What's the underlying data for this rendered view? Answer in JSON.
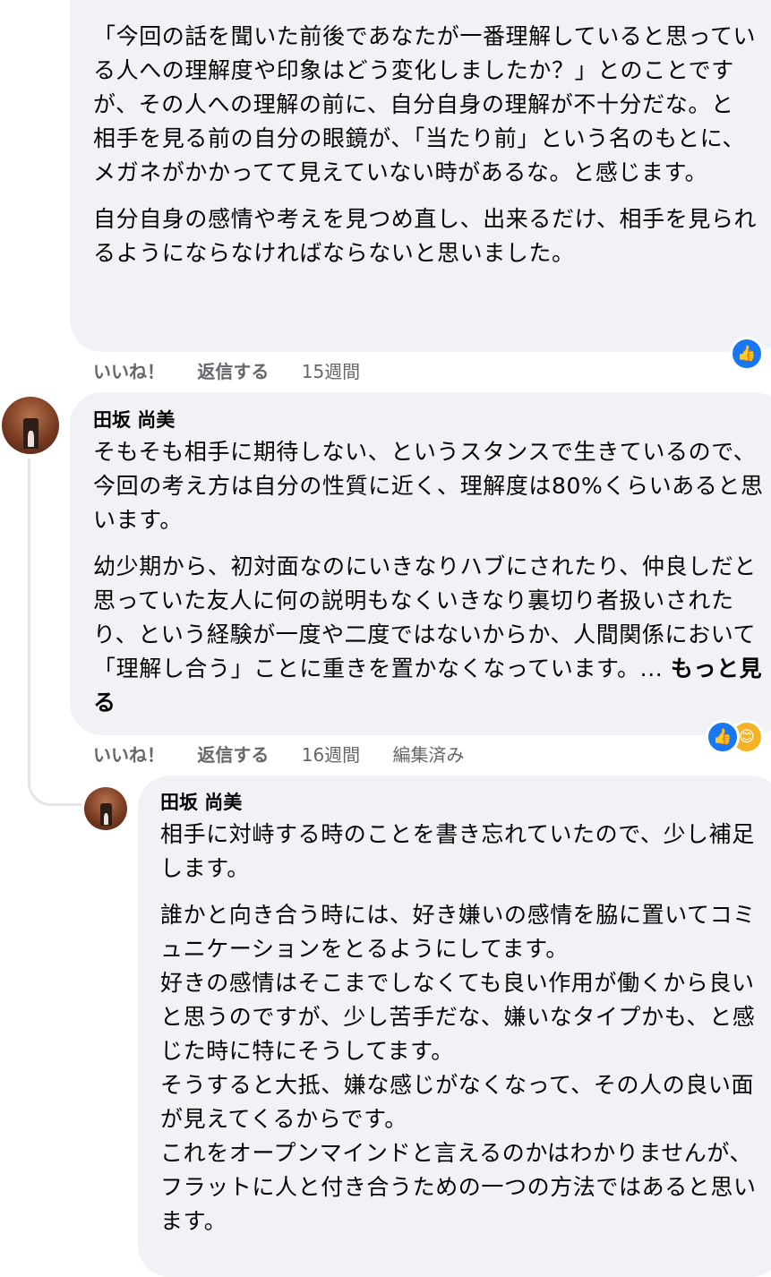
{
  "comment1": {
    "paragraphs": [
      "「今回の話を聞いた前後であなたが一番理解していると思っている人への理解度や印象はどう変化しましたか？」とのことですが、その人への理解の前に、自分自身の理解が不十分だな。と\n相手を見る前の自分の眼鏡が、「当たり前」という名のもとに、メガネがかかってて見えていない時があるな。と感じます。",
      "自分自身の感情や考えを見つめ直し、出来るだけ、相手を見られるようにならなければならないと思いました。"
    ],
    "like_label": "いいね！",
    "reply_label": "返信する",
    "time": "15週間"
  },
  "comment2": {
    "author": "田坂 尚美",
    "paragraphs": [
      "そもそも相手に期待しない、というスタンスで生きているので、今回の考え方は自分の性質に近く、理解度は80%くらいあると思います。",
      "幼少期から、初対面なのにいきなりハブにされたり、仲良しだと思っていた友人に何の説明もなくいきなり裏切り者扱いされたり、という経験が一度や二度ではないからか、人間関係において「理解し合う」ことに重きを置かなくなっています。... "
    ],
    "see_more": "もっと見る",
    "like_label": "いいね！",
    "reply_label": "返信する",
    "time": "16週間",
    "edited": "編集済み"
  },
  "reply1": {
    "author": "田坂 尚美",
    "paragraphs": [
      "相手に対峙する時のことを書き忘れていたので、少し補足します。",
      "誰かと向き合う時には、好き嫌いの感情を脇に置いてコミュニケーションをとるようにしてます。\n好きの感情はそこまでしなくても良い作用が働くから良いと思うのですが、少し苦手だな、嫌いなタイプかも、と感じた時に特にそうしてます。\nそうすると大抵、嫌な感じがなくなって、その人の良い面が見えてくるからです。\nこれをオープンマインドと言えるのかはわかりませんが、フラットに人と付き合うための一つの方法ではあると思います。"
    ]
  },
  "colors": {
    "bubble": "#f0f2f5",
    "meta": "#65676b",
    "like_blue": "#1877f2"
  }
}
